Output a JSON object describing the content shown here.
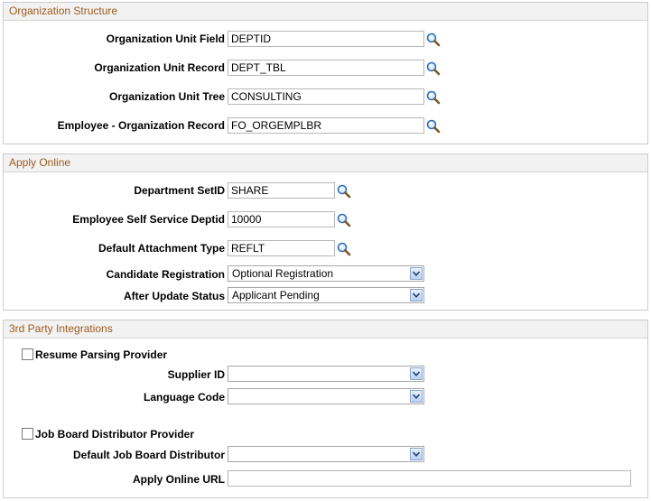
{
  "org_structure": {
    "title": "Organization Structure",
    "rows": [
      {
        "label": "Organization Unit Field",
        "value": "DEPTID"
      },
      {
        "label": "Organization Unit Record",
        "value": "DEPT_TBL"
      },
      {
        "label": "Organization Unit Tree",
        "value": "CONSULTING"
      },
      {
        "label": "Employee - Organization Record",
        "value": "FO_ORGEMPLBR"
      }
    ]
  },
  "apply_online": {
    "title": "Apply Online",
    "department_setid": {
      "label": "Department SetID",
      "value": "SHARE"
    },
    "ess_deptid": {
      "label": "Employee Self Service Deptid",
      "value": "10000"
    },
    "default_attachment_type": {
      "label": "Default Attachment Type",
      "value": "REFLT"
    },
    "candidate_registration": {
      "label": "Candidate Registration",
      "value": "Optional Registration"
    },
    "after_update_status": {
      "label": "After Update Status",
      "value": "Applicant Pending"
    }
  },
  "third_party": {
    "title": "3rd Party Integrations",
    "resume_parsing": {
      "label": "Resume Parsing Provider",
      "checked": false
    },
    "supplier_id": {
      "label": "Supplier ID",
      "value": ""
    },
    "language_code": {
      "label": "Language Code",
      "value": ""
    },
    "job_board": {
      "label": "Job Board Distributor Provider",
      "checked": false
    },
    "default_job_board": {
      "label": "Default Job Board Distributor",
      "value": ""
    },
    "apply_online_url": {
      "label": "Apply Online URL",
      "value": ""
    }
  },
  "icons": {
    "lookup": "magnifier-lookup-icon",
    "dropdown": "chevron-down-icon"
  },
  "colors": {
    "section_title": "#9c5b1d",
    "header_bg": "#f2f2f2",
    "border": "#cbcbcb"
  }
}
